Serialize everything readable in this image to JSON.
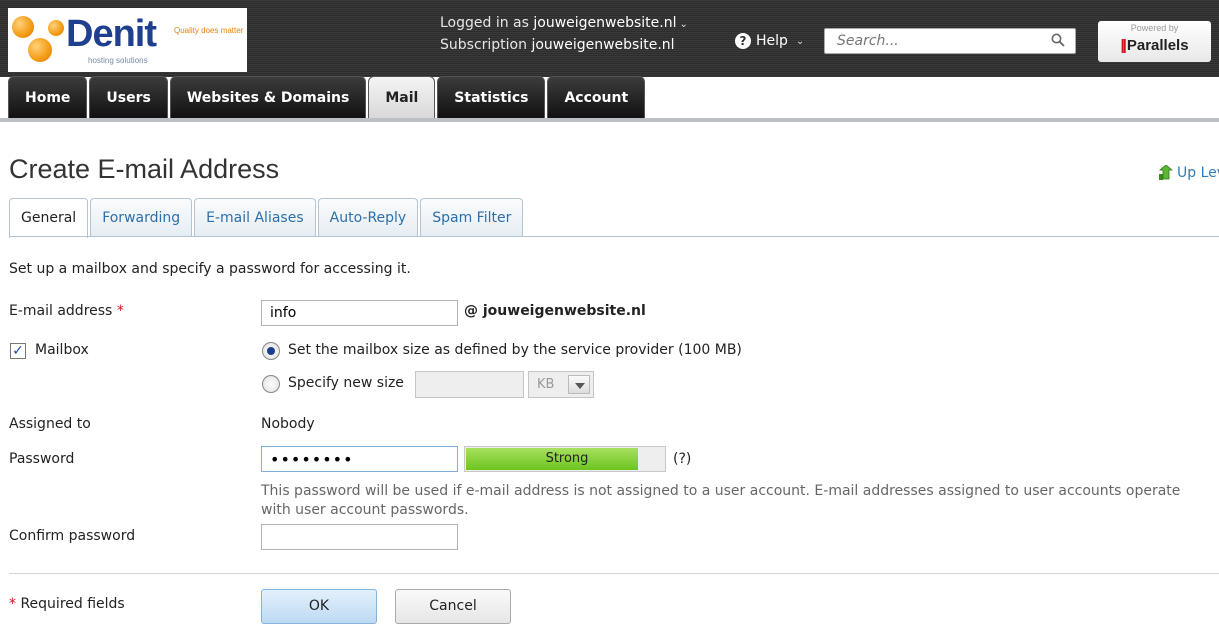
{
  "brand": {
    "name": "Denit",
    "tagline": "Quality does matter",
    "subtitle": "hosting solutions",
    "powered_by": "Powered by",
    "vendor": "Parallels"
  },
  "header": {
    "logged_in_label": "Logged in as",
    "logged_in_value": "jouweigenwebsite.nl",
    "subscription_label": "Subscription",
    "subscription_value": "jouweigenwebsite.nl",
    "help_label": "Help",
    "search_placeholder": "Search..."
  },
  "nav": {
    "tabs": [
      {
        "label": "Home",
        "active": false
      },
      {
        "label": "Users",
        "active": false
      },
      {
        "label": "Websites & Domains",
        "active": false
      },
      {
        "label": "Mail",
        "active": true
      },
      {
        "label": "Statistics",
        "active": false
      },
      {
        "label": "Account",
        "active": false
      }
    ]
  },
  "page": {
    "title": "Create E-mail Address",
    "up_level": "Up Level",
    "tabs": [
      {
        "label": "General",
        "active": true
      },
      {
        "label": "Forwarding",
        "active": false
      },
      {
        "label": "E-mail Aliases",
        "active": false
      },
      {
        "label": "Auto-Reply",
        "active": false
      },
      {
        "label": "Spam Filter",
        "active": false
      }
    ],
    "intro": "Set up a mailbox and specify a password for accessing it."
  },
  "form": {
    "email_label": "E-mail address",
    "required_mark": "*",
    "email_value": "info",
    "email_domain": "@ jouweigenwebsite.nl",
    "mailbox_label": "Mailbox",
    "mailbox_checked": true,
    "radio_default_label": "Set the mailbox size as defined by the service provider (100 MB)",
    "radio_custom_label": "Specify new size",
    "size_unit": "KB",
    "assigned_label": "Assigned to",
    "assigned_value": "Nobody",
    "password_label": "Password",
    "password_value": "••••••••",
    "strength_text": "Strong",
    "strength_fraction": 0.86,
    "strength_help": "(?)",
    "password_hint": "This password will be used if e-mail address is not assigned to a user account. E-mail addresses assigned to user accounts operate with user account passwords.",
    "confirm_label": "Confirm password",
    "confirm_value": "",
    "required_note": "Required fields",
    "ok_label": "OK",
    "cancel_label": "Cancel"
  },
  "colors": {
    "accent": "#2e7db7",
    "required": "#d0121b",
    "strength": "#6cc51f"
  }
}
